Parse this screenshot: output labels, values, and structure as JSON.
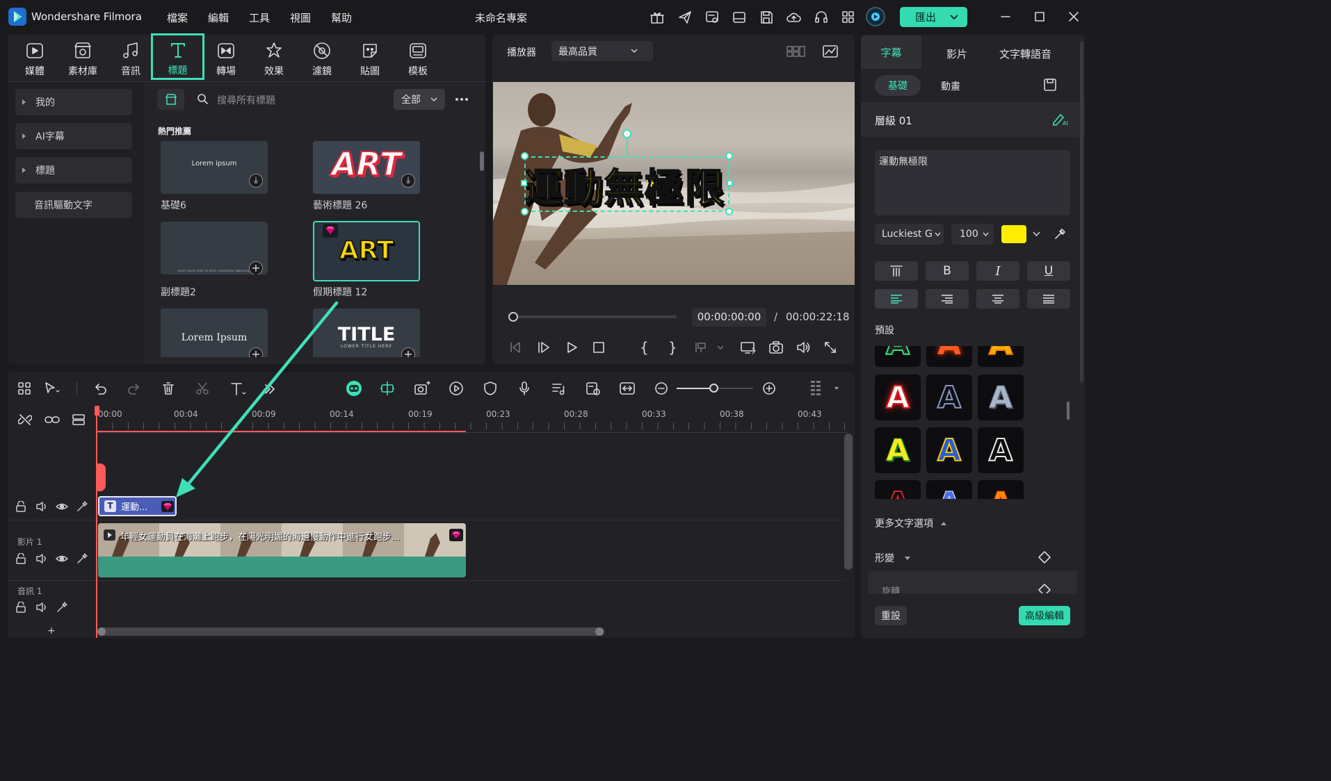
{
  "app": {
    "name": "Wondershare Filmora",
    "project_title": "未命名專案"
  },
  "menu": [
    "檔案",
    "編輯",
    "工具",
    "視圖",
    "幫助"
  ],
  "export_button": "匯出",
  "media_tabs": [
    {
      "label": "媒體",
      "icon": "media-icon"
    },
    {
      "label": "素材庫",
      "icon": "stock-icon"
    },
    {
      "label": "音訊",
      "icon": "music-icon"
    },
    {
      "label": "標題",
      "icon": "title-icon",
      "active": true
    },
    {
      "label": "轉場",
      "icon": "transition-icon"
    },
    {
      "label": "效果",
      "icon": "effects-icon"
    },
    {
      "label": "濾鏡",
      "icon": "filter-icon"
    },
    {
      "label": "貼圖",
      "icon": "sticker-icon"
    },
    {
      "label": "模板",
      "icon": "template-icon"
    }
  ],
  "sidebar": [
    "我的",
    "AI字幕",
    "標題",
    "音訊驅動文字"
  ],
  "search": {
    "placeholder": "搜尋所有標題",
    "filter": "全部"
  },
  "section_title": "熱門推薦",
  "titles": [
    {
      "label": "基礎6",
      "thumb_text": "Lorem ipsum"
    },
    {
      "label": "藝術標題 26",
      "thumb_text": "ART"
    },
    {
      "label": "副標題2",
      "thumb_text": "Lorem ipsum dolor sit amet, consectetur adipiscing"
    },
    {
      "label": "假期標題 12",
      "thumb_text": "ART"
    },
    {
      "label": "",
      "thumb_text": "Lorem Ipsum"
    },
    {
      "label": "",
      "thumb_text": "TITLE",
      "thumb_sub": "LOWER TITLE HERE"
    }
  ],
  "player": {
    "label": "播放器",
    "quality": "最高品質",
    "overlay_text": "運動無極限",
    "current_time": "00:00:00:00",
    "separator": "/",
    "total_time": "00:00:22:18",
    "progress": 0.0
  },
  "right_panel": {
    "tabs": [
      "字幕",
      "影片",
      "文字轉語音"
    ],
    "subtabs": [
      "基礎",
      "動畫"
    ],
    "layer": "層級 01",
    "text_value": "運動無極限",
    "font": "Luckiest G",
    "font_size": "100",
    "font_color": "#ffee00",
    "style_buttons": [
      "B",
      "I",
      "U"
    ],
    "presets_label": "預設",
    "more_options": "更多文字選項",
    "transform": "形變",
    "rotate": "旋轉",
    "reset": "重設",
    "advanced": "高級編輯"
  },
  "timeline": {
    "ruler": [
      "00:00",
      "00:04",
      "00:09",
      "00:14",
      "00:19",
      "00:23",
      "00:28",
      "00:33",
      "00:38",
      "00:43"
    ],
    "title_clip": "運動...",
    "video_clip": "年輕女運動員在海灘上跑步，在陽光明媚的海邊慢動作中進行女跑步...",
    "tracks": [
      "影片 1",
      "音訊 1"
    ],
    "add_track": "+",
    "zoom_level": 0.6
  },
  "colors": {
    "accent": "#3fe0b8",
    "export": "#35dbb0",
    "playhead": "#ff5a5a",
    "title_clip": "#4a5bb8",
    "video_clip": "#3a9a82"
  }
}
